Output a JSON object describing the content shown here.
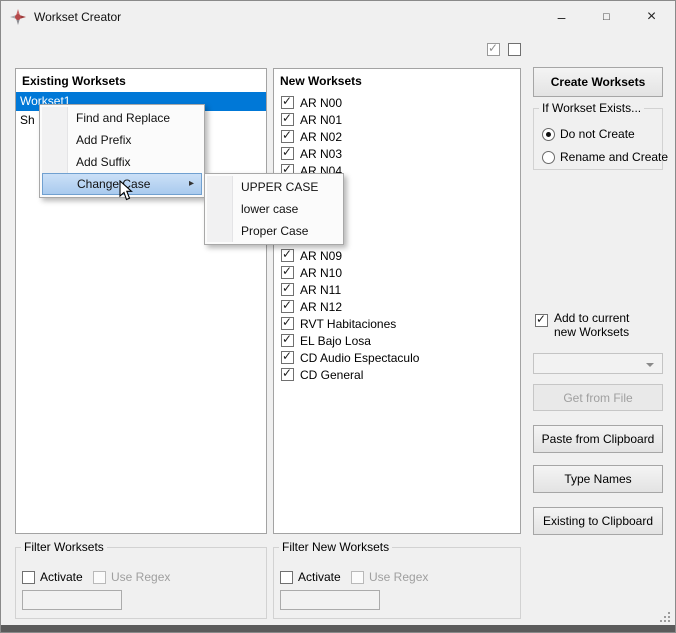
{
  "window": {
    "title": "Workset Creator"
  },
  "titlebar": {
    "minimize": "–",
    "maximize": "□",
    "close": "×"
  },
  "icons": {
    "check": "✓",
    "submenu_arrow": "▸"
  },
  "existing_worksets": {
    "header": "Existing Worksets",
    "items": [
      {
        "label": "Workset1",
        "selected": true
      },
      {
        "label": "Sh",
        "selected": false
      }
    ]
  },
  "context_menu": {
    "items": [
      {
        "label": "Find and Replace"
      },
      {
        "label": "Add Prefix"
      },
      {
        "label": "Add Suffix"
      },
      {
        "label": "Change Case"
      }
    ]
  },
  "case_submenu": {
    "items": [
      {
        "label": "UPPER CASE"
      },
      {
        "label": "lower case"
      },
      {
        "label": "Proper Case"
      }
    ]
  },
  "new_worksets": {
    "header": "New Worksets",
    "visible_top": [
      "AR N00",
      "AR N01",
      "AR N02",
      "AR N03",
      "AR N04"
    ],
    "visible_bottom": [
      "AR N09",
      "AR N10",
      "AR N11",
      "AR N12",
      "RVT Habitaciones",
      "EL Bajo Losa",
      "CD Audio Espectaculo",
      "CD General"
    ],
    "all_checked": true
  },
  "actions": {
    "create_worksets": "Create Worksets",
    "get_from_file": "Get from File",
    "paste_from_clipboard": "Paste from Clipboard",
    "type_names": "Type Names",
    "existing_to_clipboard": "Existing to Clipboard"
  },
  "if_workset_exists": {
    "label": "If Workset Exists...",
    "options": [
      "Do not Create",
      "Rename and Create"
    ],
    "selected": "Do not Create"
  },
  "add_to_current": {
    "line1": "Add to current",
    "line2": "new Worksets",
    "checked": true
  },
  "file_combo": {
    "value": ""
  },
  "filter_worksets": {
    "label": "Filter Worksets",
    "activate": "Activate",
    "use_regex": "Use Regex",
    "value": ""
  },
  "filter_new_worksets": {
    "label": "Filter New Worksets",
    "activate": "Activate",
    "use_regex": "Use Regex",
    "value": ""
  },
  "colors": {
    "selection_blue": "#0078d7",
    "menu_highlight": "#a9caee",
    "window_bg": "#f0f0f0",
    "disabled_text": "#9f9f9f"
  }
}
